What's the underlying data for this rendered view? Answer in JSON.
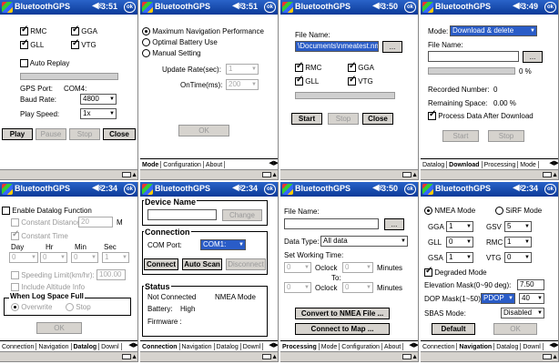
{
  "title": "BluetoothGPS",
  "common": {
    "speaker_glyph": "◀€",
    "ok": "ok"
  },
  "s1": {
    "time": "3:51",
    "rmc": "RMC",
    "gga": "GGA",
    "gll": "GLL",
    "vtg": "VTG",
    "auto_replay": "Auto Replay",
    "gps_port_label": "GPS Port:",
    "gps_port_value": "COM4:",
    "baud_label": "Baud Rate:",
    "baud_value": "4800",
    "speed_label": "Play Speed:",
    "speed_value": "1x",
    "play": "Play",
    "pause": "Pause",
    "stop": "Stop",
    "close": "Close"
  },
  "s2": {
    "time": "3:51",
    "max_nav": "Maximum Navigation Performance",
    "opt_batt": "Optimal Battery Use",
    "manual": "Manual Setting",
    "update_label": "Update Rate(sec):",
    "update_value": "1",
    "ontime_label": "OnTime(ms):",
    "ontime_value": "200",
    "ok_btn": "OK",
    "tabs": [
      "Mode",
      "Configuration",
      "About"
    ]
  },
  "s3": {
    "time": "3:50",
    "file_label": "File Name:",
    "file_value": "\\Documents\\nmeatest.nmea",
    "browse": "...",
    "rmc": "RMC",
    "gga": "GGA",
    "gll": "GLL",
    "vtg": "VTG",
    "start": "Start",
    "stop": "Stop",
    "close": "Close"
  },
  "s4": {
    "time": "3:49",
    "mode_label": "Mode:",
    "mode_value": "Download & delete",
    "file_label": "File Name:",
    "browse": "...",
    "pct": "0 %",
    "recorded_label": "Recorded Number:",
    "recorded_value": "0",
    "remaining_label": "Remaining Space:",
    "remaining_value": "0.00 %",
    "process": "Process Data After Download",
    "start": "Start",
    "stop": "Stop",
    "tabs": [
      "Datalog",
      "Download",
      "Processing",
      "Mode"
    ]
  },
  "s5": {
    "time": "2:34",
    "enable": "Enable Datalog Function",
    "const_dist": "Constant Distance",
    "const_dist_value": "20",
    "unit_m": "M",
    "const_time": "Constant Time",
    "day": "Day",
    "hr": "Hr",
    "min": "Min",
    "sec": "Sec",
    "zero": "0",
    "one": "1",
    "speed_limit": "Speeding Limit(km/hr):",
    "speed_value": "100.00",
    "altitude": "Include Altitude Info",
    "full_title": "When Log Space Full",
    "overwrite": "Overwrite",
    "stop": "Stop",
    "ok_btn": "OK",
    "tabs": [
      "Connection",
      "Navigation",
      "Datalog",
      "Downl"
    ]
  },
  "s6": {
    "time": "2:34",
    "device_title": "Device Name",
    "change": "Change",
    "conn_title": "Connection",
    "com_label": "COM  Port:",
    "com_value": "COM1:",
    "connect": "Connect",
    "auto_scan": "Auto Scan",
    "disconnect": "Disconnect",
    "status_title": "Status",
    "not_connected": "Not Connected",
    "nmea_mode": "NMEA Mode",
    "battery_label": "Battery:",
    "battery_value": "High",
    "firmware_label": "Firmware :",
    "tabs": [
      "Connection",
      "Navigation",
      "Datalog",
      "Downl"
    ]
  },
  "s7": {
    "time": "3:50",
    "file_label": "File Name:",
    "browse": "...",
    "dtype_label": "Data Type:",
    "dtype_value": "All data",
    "swt_label": "Set Working Time:",
    "zero": "0",
    "oclock": "Oclock",
    "minutes": "Minutes",
    "to": "To:",
    "convert_nmea": "Convert to NMEA File ...",
    "convert_map": "Connect to Map ...",
    "tabs": [
      "Processing",
      "Mode",
      "Configuration",
      "About"
    ]
  },
  "s8": {
    "time": "2:34",
    "nmea_mode": "NMEA Mode",
    "sirf_mode": "SiRF Mode",
    "gga": "GGA",
    "gga_v": "1",
    "gsv": "GSV",
    "gsv_v": "5",
    "gll": "GLL",
    "gll_v": "0",
    "rmc": "RMC",
    "rmc_v": "1",
    "gsa": "GSA",
    "gsa_v": "1",
    "vtg": "VTG",
    "vtg_v": "0",
    "degraded": "Degraded Mode",
    "elev_label": "Elevation Mask(0~90 deg):",
    "elev_value": "7.50",
    "dop_label": "DOP Mask(1~50)",
    "dop_type": "PDOP",
    "dop_value": "40",
    "sbas_label": "SBAS Mode:",
    "sbas_value": "Disabled",
    "default": "Default",
    "ok_btn": "OK",
    "tabs": [
      "Connection",
      "Navigation",
      "Datalog",
      "Downl"
    ]
  }
}
